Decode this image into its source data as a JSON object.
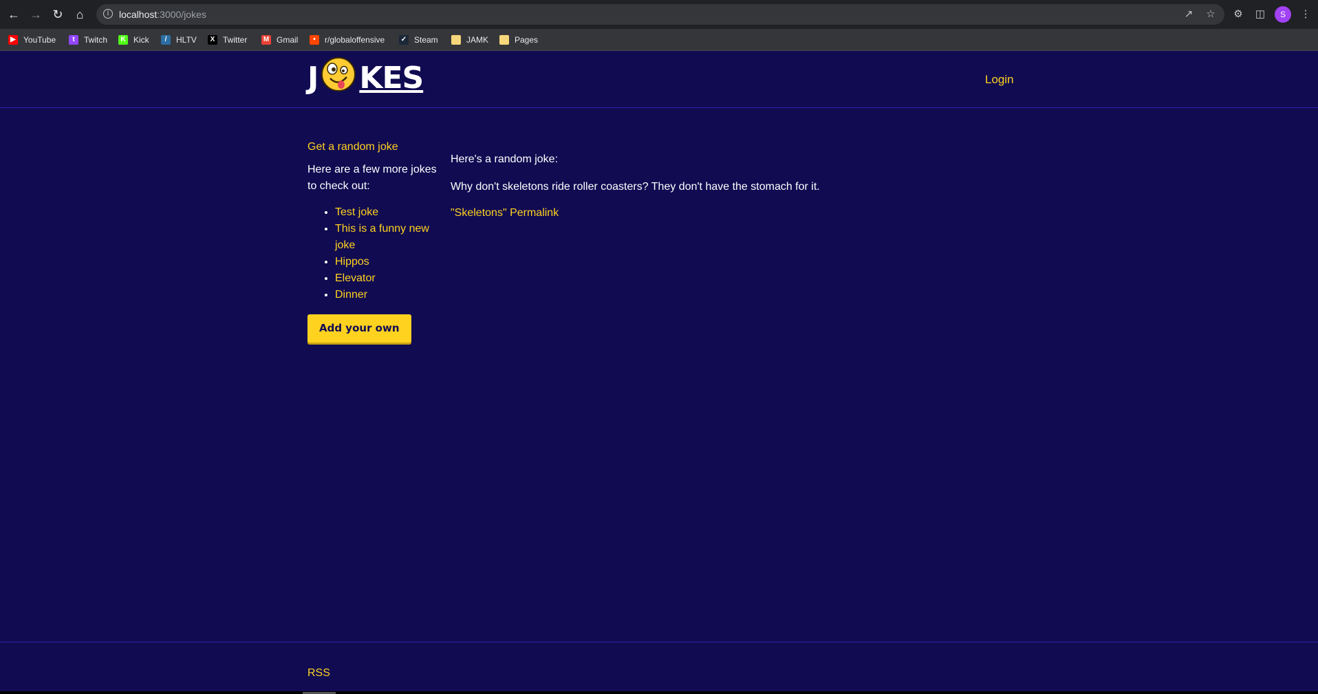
{
  "browser": {
    "url_host": "localhost",
    "url_path": ":3000/jokes",
    "profile_initial": "S",
    "bookmarks": [
      {
        "label": "YouTube",
        "icon": "youtube-icon",
        "color": "#ff0000"
      },
      {
        "label": "Twitch",
        "icon": "twitch-icon",
        "color": "#9146ff"
      },
      {
        "label": "Kick",
        "icon": "kick-icon",
        "color": "#53fc18"
      },
      {
        "label": "HLTV",
        "icon": "hltv-icon",
        "color": "#2b6ea4"
      },
      {
        "label": "Twitter",
        "icon": "x-icon",
        "color": "#000000"
      },
      {
        "label": "Gmail",
        "icon": "gmail-icon",
        "color": "#ea4335"
      },
      {
        "label": "r/globaloffensive",
        "icon": "reddit-icon",
        "color": "#ff4500"
      },
      {
        "label": "Steam",
        "icon": "steam-icon",
        "color": "#1b2838"
      },
      {
        "label": "JAMK",
        "icon": "folder-icon",
        "color": "#f6d67a"
      },
      {
        "label": "Pages",
        "icon": "folder-icon",
        "color": "#f6d67a"
      }
    ]
  },
  "header": {
    "logo_left": "J",
    "logo_right": "KES",
    "login_label": "Login"
  },
  "sidebar": {
    "random_link": "Get a random joke",
    "intro": "Here are a few more jokes to check out:",
    "jokes": [
      "Test joke",
      "This is a funny new joke",
      "Hippos",
      "Elevator",
      "Dinner"
    ],
    "add_button": "Add your own"
  },
  "main": {
    "heading": "Here's a random joke:",
    "joke_text": "Why don't skeletons ride roller coasters? They don't have the stomach for it.",
    "permalink": "\"Skeletons\" Permalink"
  },
  "footer": {
    "rss_label": "RSS"
  },
  "colors": {
    "background": "#110b52",
    "accent": "#ffd21f",
    "divider": "#2a24a6"
  }
}
